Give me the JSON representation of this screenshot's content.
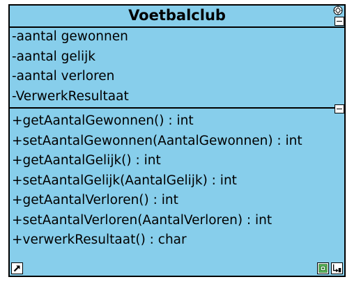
{
  "class": {
    "name": "Voetbalclub",
    "attributes": [
      "-aantal gewonnen",
      "-aantal gelijk",
      "-aantal verloren",
      "-VerwerkResultaat"
    ],
    "operations": [
      "+getAantalGewonnen() : int",
      "+setAantalGewonnen(AantalGewonnen) : int",
      "+getAantalGelijk() : int",
      "+setAantalGelijk(AantalGelijk) : int",
      "+getAantalVerloren() : int",
      "+setAantalVerloren(AantalVerloren) : int",
      "+verwerkResultaat() : char"
    ],
    "fill_color": "#87ceeb"
  },
  "icons": {
    "settings": "gear-icon",
    "collapse_attributes": "collapse-icon",
    "collapse_operations": "collapse-icon",
    "link": "arrow-link-icon",
    "element": "element-icon",
    "navigate": "navigate-icon"
  }
}
